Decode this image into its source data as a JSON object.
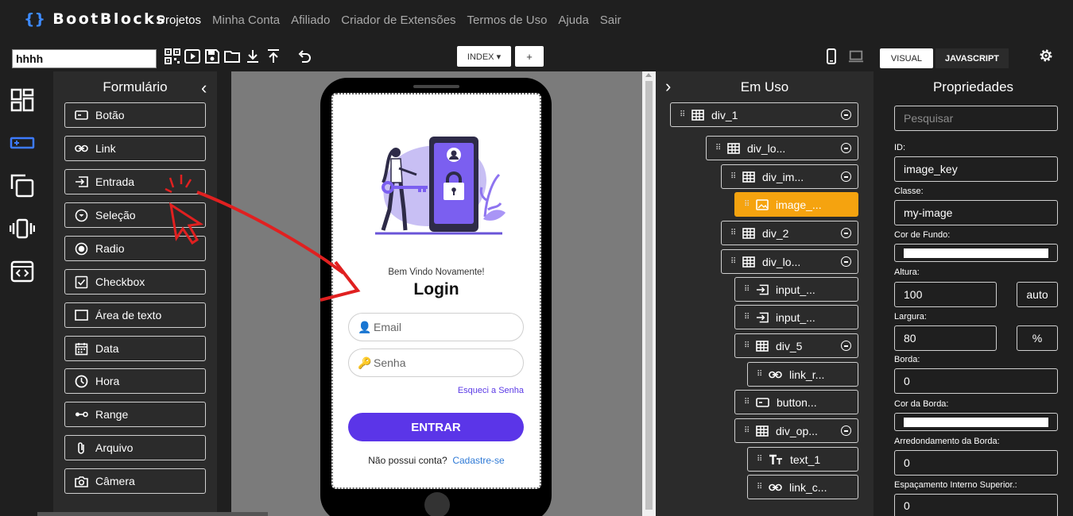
{
  "app": {
    "brand": "BootBlocks",
    "brand_prefix": "{}",
    "nav": [
      "Projetos",
      "Minha Conta",
      "Afiliado",
      "Criador de Extensões",
      "Termos de Uso",
      "Ajuda",
      "Sair"
    ]
  },
  "toolbar": {
    "project_name": "hhhh",
    "page_select": "INDEX ▾",
    "add_page": "+",
    "tab_visual": "VISUAL",
    "tab_javascript": "JAVASCRIPT",
    "icons": [
      "qr-code-icon",
      "play-icon",
      "save-icon",
      "folder-icon",
      "download-icon",
      "upload-icon",
      "undo-icon",
      "mobile-icon",
      "desktop-icon",
      "gear-icon"
    ]
  },
  "components_panel": {
    "title": "Formulário",
    "items": [
      {
        "label": "Botão",
        "icon": "button-icon"
      },
      {
        "label": "Link",
        "icon": "link-icon"
      },
      {
        "label": "Entrada",
        "icon": "input-icon"
      },
      {
        "label": "Seleção",
        "icon": "select-icon"
      },
      {
        "label": "Radio",
        "icon": "radio-icon"
      },
      {
        "label": "Checkbox",
        "icon": "checkbox-icon"
      },
      {
        "label": "Área de texto",
        "icon": "textarea-icon"
      },
      {
        "label": "Data",
        "icon": "calendar-icon"
      },
      {
        "label": "Hora",
        "icon": "clock-icon"
      },
      {
        "label": "Range",
        "icon": "range-icon"
      },
      {
        "label": "Arquivo",
        "icon": "paperclip-icon"
      },
      {
        "label": "Câmera",
        "icon": "camera-icon"
      }
    ]
  },
  "preview": {
    "welcome": "Bem Vindo Novamente!",
    "title": "Login",
    "email_placeholder": "Email",
    "password_placeholder": "Senha",
    "forgot": "Esqueci a Senha",
    "enter": "ENTRAR",
    "no_account": "Não possui conta?",
    "signup": "Cadastre-se"
  },
  "tree_panel": {
    "title": "Em Uso",
    "nodes": [
      {
        "label": "div_1",
        "icon": "grid-icon",
        "toggle": true,
        "selected": false
      },
      {
        "label": "div_lo...",
        "icon": "grid-icon",
        "toggle": true,
        "selected": false
      },
      {
        "label": "div_im...",
        "icon": "grid-icon",
        "toggle": true,
        "selected": false
      },
      {
        "label": "image_...",
        "icon": "image-icon",
        "toggle": false,
        "selected": true
      },
      {
        "label": "div_2",
        "icon": "grid-icon",
        "toggle": true,
        "selected": false
      },
      {
        "label": "div_lo...",
        "icon": "grid-icon",
        "toggle": true,
        "selected": false
      },
      {
        "label": "input_...",
        "icon": "input-icon",
        "toggle": false,
        "selected": false
      },
      {
        "label": "input_...",
        "icon": "input-icon",
        "toggle": false,
        "selected": false
      },
      {
        "label": "div_5",
        "icon": "grid-icon",
        "toggle": true,
        "selected": false
      },
      {
        "label": "link_r...",
        "icon": "link-icon",
        "toggle": false,
        "selected": false
      },
      {
        "label": "button...",
        "icon": "button-icon",
        "toggle": false,
        "selected": false
      },
      {
        "label": "div_op...",
        "icon": "grid-icon",
        "toggle": true,
        "selected": false
      },
      {
        "label": "text_1",
        "icon": "text-icon",
        "toggle": false,
        "selected": false
      },
      {
        "label": "link_c...",
        "icon": "link-icon",
        "toggle": false,
        "selected": false
      }
    ]
  },
  "properties": {
    "title": "Propriedades",
    "search_placeholder": "Pesquisar",
    "id_label": "ID:",
    "id_value": "image_key",
    "class_label": "Classe:",
    "class_value": "my-image",
    "bg_label": "Cor de Fundo:",
    "bg_color": "#ffffff",
    "height_label": "Altura:",
    "height_value": "100",
    "height_unit": "auto",
    "width_label": "Largura:",
    "width_value": "80",
    "width_unit": "%",
    "border_label": "Borda:",
    "border_value": "0",
    "border_color_label": "Cor da Borda:",
    "border_color": "#ffffff",
    "radius_label": "Arredondamento da Borda:",
    "radius_value": "0",
    "padding_top_label": "Espaçamento Interno Superior.:",
    "padding_top_value": "0"
  },
  "colors": {
    "accent": "#5b35e8",
    "selected_node": "#f5a30f",
    "link": "#2f7ad6",
    "annotation_arrow": "#e02020"
  }
}
